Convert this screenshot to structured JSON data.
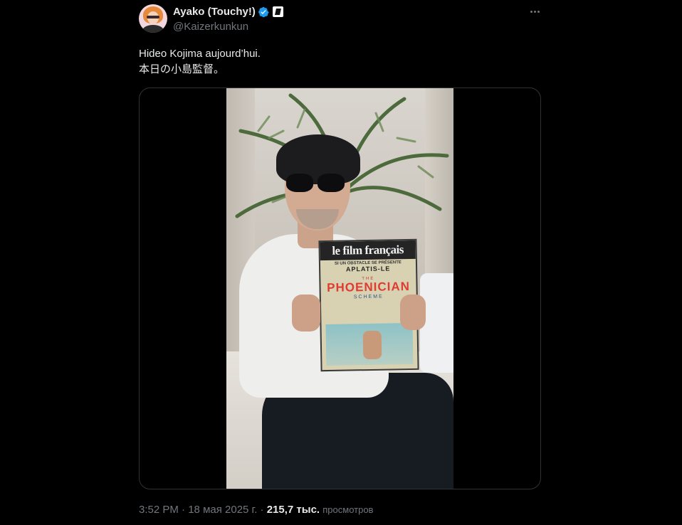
{
  "author": {
    "display_name": "Ayako (Touchy!)",
    "handle": "@Kaizerkunkun",
    "verified_icon": "verified-badge-icon",
    "affiliate_icon": "affiliate-badge-icon"
  },
  "tweet": {
    "lines": [
      "Hideo Kojima aujourd’hui.",
      "本日の小島監督。"
    ]
  },
  "media": {
    "magazine": {
      "masthead": "le film français",
      "subtitle": "SI UN OBSTACLE SE PRÉSENTE",
      "headline": "APLATIS-LE",
      "the": "THE",
      "title": "PHOENICIAN",
      "scheme": "SCHEME"
    }
  },
  "footer": {
    "time": "3:52 PM",
    "separator": "·",
    "date": "18 мая 2025 г.",
    "views_count": "215,7 тыс.",
    "views_label": "просмотров"
  },
  "colors": {
    "background": "#000000",
    "text": "#e7e9ea",
    "secondary": "#71767b",
    "verified": "#1d9bf0"
  }
}
